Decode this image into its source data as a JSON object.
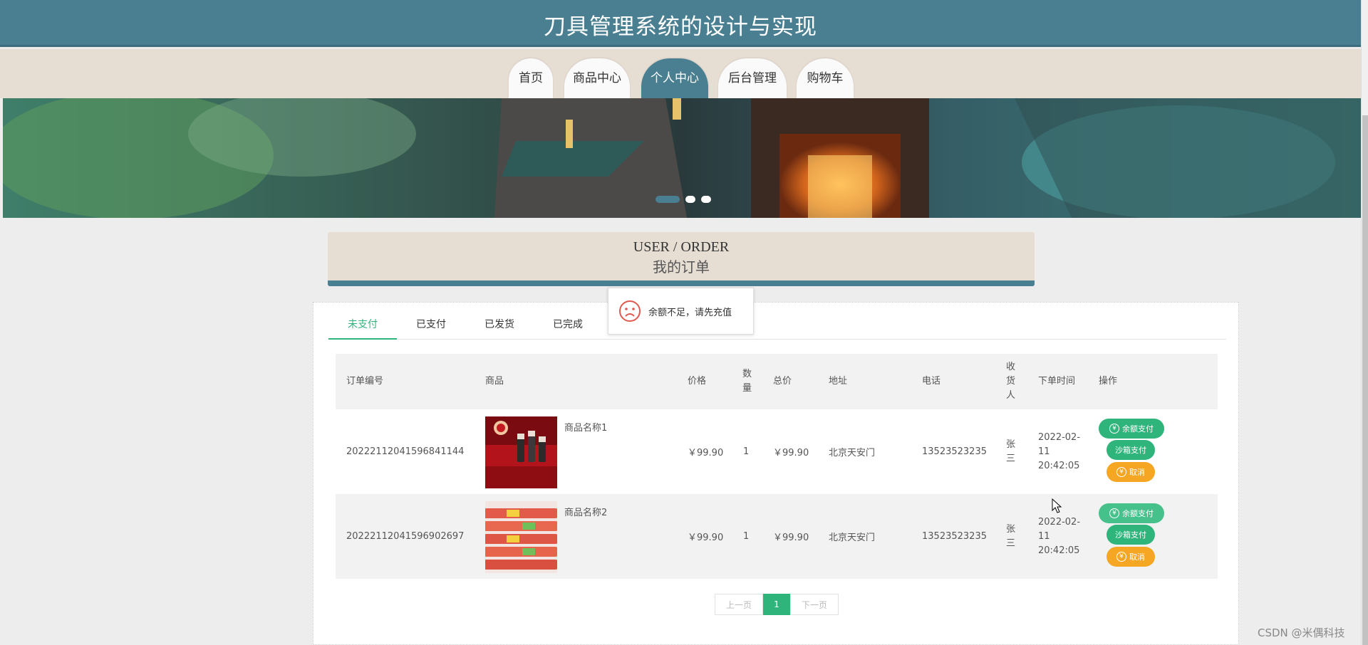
{
  "header": {
    "title": "刀具管理系统的设计与实现"
  },
  "nav": {
    "items": [
      {
        "label": "首页"
      },
      {
        "label": "商品中心"
      },
      {
        "label": "个人中心"
      },
      {
        "label": "后台管理"
      },
      {
        "label": "购物车"
      }
    ],
    "active": "个人中心"
  },
  "banner": {
    "slides": 3,
    "active_slide": 1
  },
  "page_title": {
    "en": "USER / ORDER",
    "cn": "我的订单"
  },
  "tabs": [
    {
      "label": "未支付"
    },
    {
      "label": "已支付"
    },
    {
      "label": "已发货"
    },
    {
      "label": "已完成"
    }
  ],
  "active_tab": "未支付",
  "table": {
    "headers": {
      "order_no": "订单编号",
      "product": "商品",
      "price": "价格",
      "qty": "数量",
      "total": "总价",
      "address": "地址",
      "phone": "电话",
      "receiver": "收货人",
      "time": "下单时间",
      "ops": "操作"
    },
    "rows": [
      {
        "order_no": "20222112041596841144",
        "product_name": "商品名称1",
        "price": "￥99.90",
        "qty": "1",
        "total": "￥99.90",
        "address": "北京天安门",
        "phone": "13523523235",
        "receiver": "张三",
        "time": "2022-02-11 20:42:05"
      },
      {
        "order_no": "20222112041596902697",
        "product_name": "商品名称2",
        "price": "￥99.90",
        "qty": "1",
        "total": "￥99.90",
        "address": "北京天安门",
        "phone": "13523523235",
        "receiver": "张三",
        "time": "2022-02-11 20:42:05"
      }
    ],
    "actions": {
      "balance_pay": "余额支付",
      "sandbox_pay": "沙箱支付",
      "cancel": "取消",
      "yen_symbol": "¥"
    }
  },
  "pagination": {
    "prev": "上一页",
    "current": "1",
    "next": "下一页"
  },
  "toast": {
    "message": "余额不足，请先充值"
  },
  "watermark": "CSDN @米偶科技",
  "colors": {
    "primary": "#4a7f91",
    "accent": "#2fb57c",
    "warning": "#f5a623",
    "beige": "#e6ddd3"
  }
}
